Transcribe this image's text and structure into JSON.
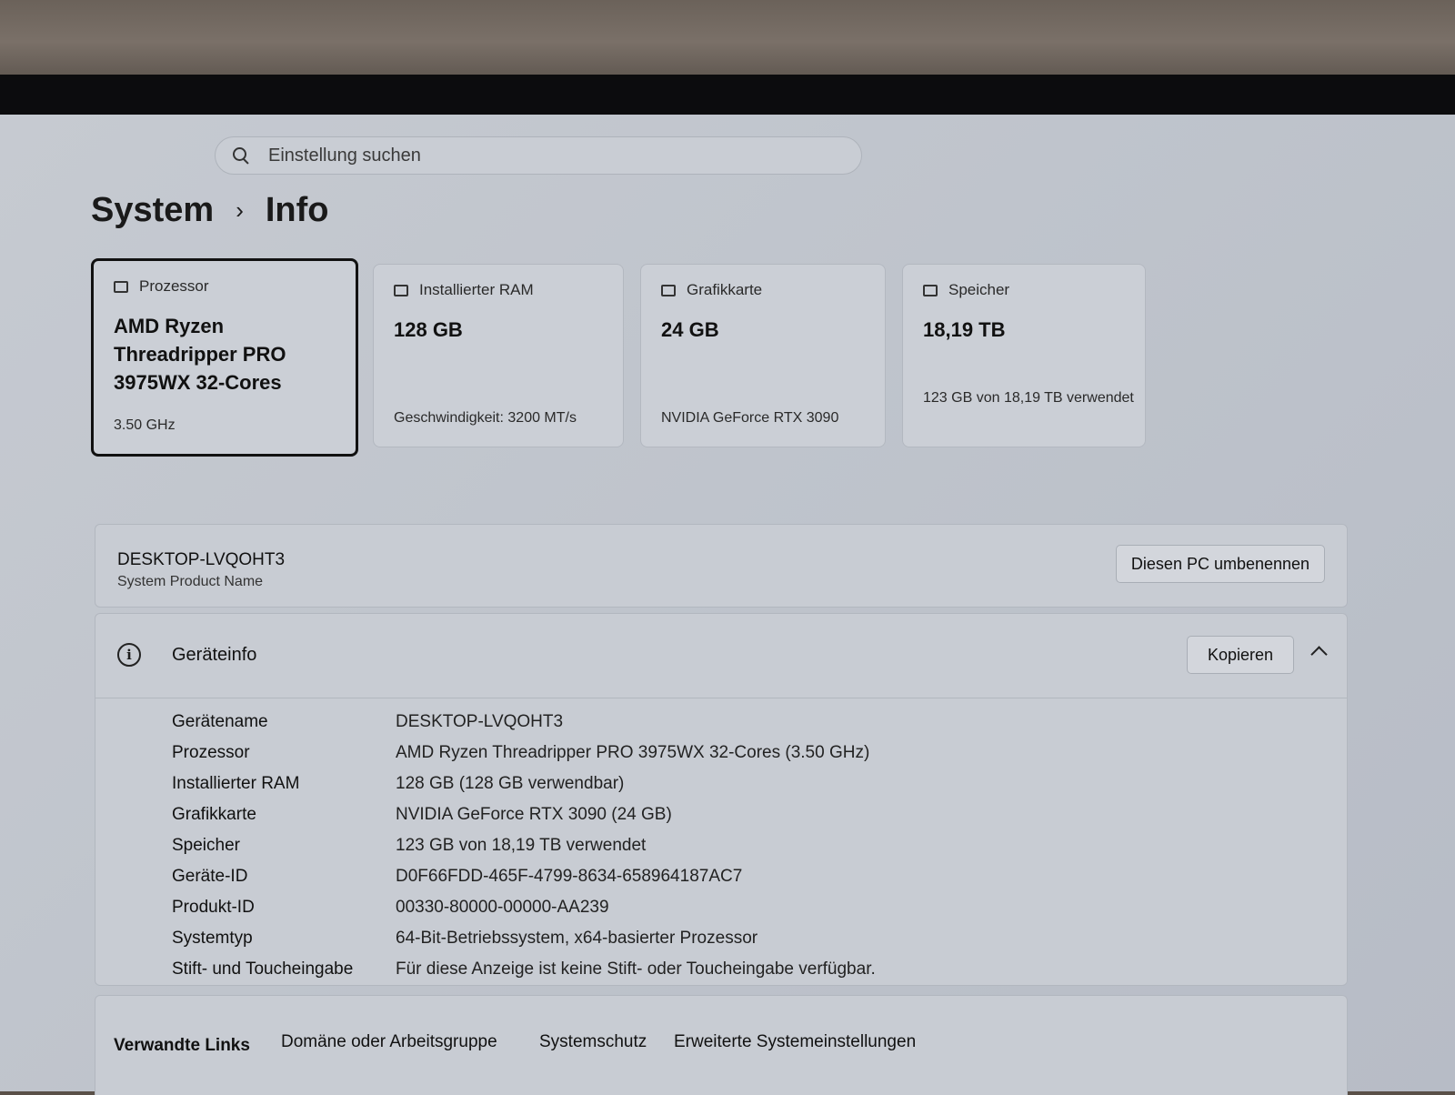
{
  "search": {
    "placeholder": "Einstellung suchen"
  },
  "breadcrumb": {
    "parent": "System",
    "separator": "›",
    "current": "Info"
  },
  "cards": [
    {
      "label": "Prozessor",
      "value": "AMD Ryzen Threadripper PRO 3975WX 32-Cores",
      "sub": "3.50 GHz",
      "icon": "processor-icon",
      "selected": true
    },
    {
      "label": "Installierter RAM",
      "value": "128 GB",
      "sub": "Geschwindigkeit: 3200 MT/s",
      "icon": "ram-icon"
    },
    {
      "label": "Grafikkarte",
      "value": "24 GB",
      "sub": "NVIDIA GeForce RTX 3090",
      "icon": "gpu-icon"
    },
    {
      "label": "Speicher",
      "value": "18,19 TB",
      "sub": "123 GB von 18,19 TB verwendet",
      "icon": "storage-icon"
    }
  ],
  "pc": {
    "name": "DESKTOP-LVQOHT3",
    "product": "System Product Name",
    "rename_label": "Diesen PC umbenennen"
  },
  "device_info": {
    "title": "Geräteinfo",
    "copy_label": "Kopieren",
    "rows": [
      {
        "key": "Gerätename",
        "value": "DESKTOP-LVQOHT3"
      },
      {
        "key": "Prozessor",
        "value": "AMD Ryzen Threadripper PRO 3975WX 32-Cores (3.50 GHz)"
      },
      {
        "key": "Installierter RAM",
        "value": "128 GB (128 GB verwendbar)"
      },
      {
        "key": "Grafikkarte",
        "value": "NVIDIA GeForce RTX 3090 (24 GB)"
      },
      {
        "key": "Speicher",
        "value": "123 GB von 18,19 TB verwendet"
      },
      {
        "key": "Geräte-ID",
        "value": "D0F66FDD-465F-4799-8634-658964187AC7"
      },
      {
        "key": "Produkt-ID",
        "value": "00330-80000-00000-AA239"
      },
      {
        "key": "Systemtyp",
        "value": "64-Bit-Betriebssystem, x64-basierter Prozessor"
      },
      {
        "key": "Stift- und Toucheingabe",
        "value": "Für diese Anzeige ist keine Stift- oder Toucheingabe verfügbar."
      }
    ]
  },
  "related": {
    "label": "Verwandte Links",
    "links": [
      "Domäne oder Arbeitsgruppe",
      "Systemschutz",
      "Erweiterte Systemeinstellungen"
    ]
  }
}
